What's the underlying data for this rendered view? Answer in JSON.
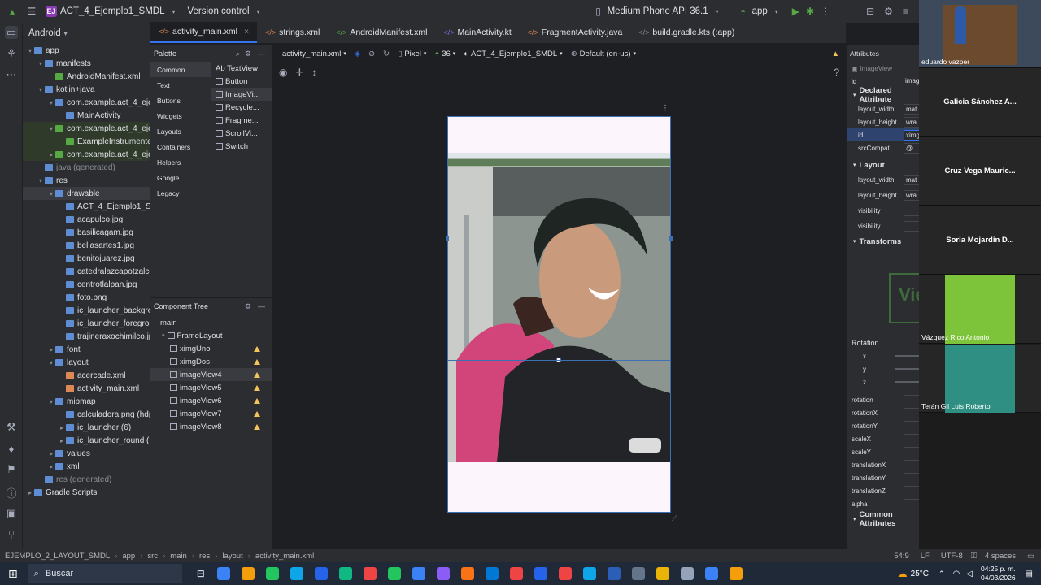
{
  "titlebar": {
    "project_badge": "EJ",
    "project_name": "ACT_4_Ejemplo1_SMDL",
    "vcs": "Version control",
    "device": "Medium Phone API 36.1",
    "run_config": "app"
  },
  "project_panel": {
    "view": "Android",
    "tree": [
      {
        "label": "app",
        "depth": 0,
        "arrow": "▾",
        "color": "#5f8dd3"
      },
      {
        "label": "manifests",
        "depth": 1,
        "arrow": "▾",
        "color": "#5f8dd3"
      },
      {
        "label": "AndroidManifest.xml",
        "depth": 2,
        "arrow": "",
        "color": "#56a845"
      },
      {
        "label": "kotlin+java",
        "depth": 1,
        "arrow": "▾",
        "color": "#5f8dd3"
      },
      {
        "label": "com.example.act_4_ejer",
        "depth": 2,
        "arrow": "▾",
        "color": "#5f8dd3"
      },
      {
        "label": "MainActivity",
        "depth": 3,
        "arrow": "",
        "color": "#5f8dd3"
      },
      {
        "label": "com.example.act_4_ejer",
        "depth": 2,
        "arrow": "▾",
        "color": "#56a845",
        "hl": true
      },
      {
        "label": "ExampleInstrumente",
        "depth": 3,
        "arrow": "",
        "color": "#56a845",
        "hl": true
      },
      {
        "label": "com.example.act_4_ejer",
        "depth": 2,
        "arrow": "▸",
        "color": "#56a845",
        "hl": true
      },
      {
        "label": "java (generated)",
        "depth": 1,
        "arrow": "",
        "color": "#5f8dd3",
        "gen": true
      },
      {
        "label": "res",
        "depth": 1,
        "arrow": "▾",
        "color": "#5f8dd3"
      },
      {
        "label": "drawable",
        "depth": 2,
        "arrow": "▾",
        "color": "#5f8dd3",
        "sel": true
      },
      {
        "label": "ACT_4_Ejemplo1_SMDL",
        "depth": 3,
        "arrow": "",
        "color": "#5f8dd3"
      },
      {
        "label": "acapulco.jpg",
        "depth": 3,
        "arrow": "",
        "color": "#5f8dd3"
      },
      {
        "label": "basilicagam.jpg",
        "depth": 3,
        "arrow": "",
        "color": "#5f8dd3"
      },
      {
        "label": "bellasartes1.jpg",
        "depth": 3,
        "arrow": "",
        "color": "#5f8dd3"
      },
      {
        "label": "benitojuarez.jpg",
        "depth": 3,
        "arrow": "",
        "color": "#5f8dd3"
      },
      {
        "label": "catedralazcapotzalco",
        "depth": 3,
        "arrow": "",
        "color": "#5f8dd3"
      },
      {
        "label": "centrotlalpan.jpg",
        "depth": 3,
        "arrow": "",
        "color": "#5f8dd3"
      },
      {
        "label": "foto.png",
        "depth": 3,
        "arrow": "",
        "color": "#5f8dd3"
      },
      {
        "label": "ic_launcher_backgro",
        "depth": 3,
        "arrow": "",
        "color": "#5f8dd3"
      },
      {
        "label": "ic_launcher_foregrou",
        "depth": 3,
        "arrow": "",
        "color": "#5f8dd3"
      },
      {
        "label": "trajineraxochimilco.jp",
        "depth": 3,
        "arrow": "",
        "color": "#5f8dd3"
      },
      {
        "label": "font",
        "depth": 2,
        "arrow": "▸",
        "color": "#5f8dd3"
      },
      {
        "label": "layout",
        "depth": 2,
        "arrow": "▾",
        "color": "#5f8dd3"
      },
      {
        "label": "acercade.xml",
        "depth": 3,
        "arrow": "",
        "color": "#e08855"
      },
      {
        "label": "activity_main.xml",
        "depth": 3,
        "arrow": "",
        "color": "#e08855"
      },
      {
        "label": "mipmap",
        "depth": 2,
        "arrow": "▾",
        "color": "#5f8dd3"
      },
      {
        "label": "calculadora.png (hdp",
        "depth": 3,
        "arrow": "",
        "color": "#5f8dd3"
      },
      {
        "label": "ic_launcher (6)",
        "depth": 3,
        "arrow": "▸",
        "color": "#5f8dd3"
      },
      {
        "label": "ic_launcher_round (6",
        "depth": 3,
        "arrow": "▸",
        "color": "#5f8dd3"
      },
      {
        "label": "values",
        "depth": 2,
        "arrow": "▸",
        "color": "#5f8dd3"
      },
      {
        "label": "xml",
        "depth": 2,
        "arrow": "▸",
        "color": "#5f8dd3"
      },
      {
        "label": "res (generated)",
        "depth": 1,
        "arrow": "",
        "color": "#5f8dd3",
        "gen": true
      },
      {
        "label": "Gradle Scripts",
        "depth": 0,
        "arrow": "▸",
        "color": "#5f8dd3"
      }
    ]
  },
  "tabs": [
    {
      "label": "activity_main.xml",
      "active": true,
      "color": "#e08855",
      "close": "×"
    },
    {
      "label": "strings.xml",
      "active": false,
      "color": "#e08855",
      "close": ""
    },
    {
      "label": "AndroidManifest.xml",
      "active": false,
      "color": "#56a845",
      "close": ""
    },
    {
      "label": "MainActivity.kt",
      "active": false,
      "color": "#7f6bdd",
      "close": ""
    },
    {
      "label": "FragmentActivity.java",
      "active": false,
      "color": "#e08855",
      "close": ""
    },
    {
      "label": "build.gradle.kts (:app)",
      "active": false,
      "color": "#8c8f96",
      "close": ""
    }
  ],
  "palette": {
    "title": "Palette",
    "categories": [
      "Common",
      "Text",
      "Buttons",
      "Widgets",
      "Layouts",
      "Containers",
      "Helpers",
      "Google",
      "Legacy"
    ],
    "items": [
      "Ab TextView",
      "Button",
      "ImageVi...",
      "Recycle...",
      "Fragme...",
      "ScrollVi...",
      "Switch"
    ]
  },
  "component_tree": {
    "title": "Component Tree",
    "rows": [
      {
        "label": "main",
        "depth": 0,
        "warn": false,
        "sel": false
      },
      {
        "label": "FrameLayout",
        "depth": 1,
        "warn": false,
        "sel": false
      },
      {
        "label": "ximgUno",
        "depth": 2,
        "warn": true,
        "sel": false
      },
      {
        "label": "ximgDos",
        "depth": 2,
        "warn": true,
        "sel": false
      },
      {
        "label": "imageView4",
        "depth": 2,
        "warn": true,
        "sel": true
      },
      {
        "label": "imageView5",
        "depth": 2,
        "warn": true,
        "sel": false
      },
      {
        "label": "imageView6",
        "depth": 2,
        "warn": true,
        "sel": false
      },
      {
        "label": "imageView7",
        "depth": 2,
        "warn": true,
        "sel": false
      },
      {
        "label": "imageView8",
        "depth": 2,
        "warn": true,
        "sel": false
      }
    ]
  },
  "design_toolbar": {
    "file": "activity_main.xml",
    "device": "Pixel",
    "api": "36",
    "theme": "ACT_4_Ejemplo1_SMDL",
    "locale": "Default (en-us)"
  },
  "attributes": {
    "title": "Attributes",
    "component": "ImageView",
    "id_label": "id",
    "id_value": "imag",
    "declared": "Declared Attribute",
    "declared_rows": [
      {
        "k": "layout_width",
        "v": "mat"
      },
      {
        "k": "layout_height",
        "v": "wra"
      },
      {
        "k": "id",
        "v": "ximg"
      },
      {
        "k": "srcCompat",
        "v": "@"
      }
    ],
    "layout_section": "Layout",
    "layout_rows": [
      {
        "k": "layout_width",
        "v": "mat"
      },
      {
        "k": "layout_height",
        "v": "wra"
      },
      {
        "k": "visibility",
        "v": ""
      },
      {
        "k": "visibility",
        "v": ""
      }
    ],
    "transforms": "Transforms",
    "preview_text": "Vie",
    "rotation_label": "Rotation",
    "axes": [
      "x",
      "y",
      "z"
    ],
    "transform_rows": [
      "rotation",
      "rotationX",
      "rotationY",
      "scaleX",
      "scaleY",
      "translationX",
      "translationY",
      "translationZ",
      "alpha"
    ],
    "common": "Common Attributes"
  },
  "video_call": {
    "participants": [
      {
        "name": "eduardo vazper",
        "type": "video"
      },
      {
        "name": "Galicia Sánchez A...",
        "type": "text"
      },
      {
        "name": "Cruz Vega Mauric...",
        "type": "text"
      },
      {
        "name": "Soria Mojardin D...",
        "type": "text"
      },
      {
        "name": "Vázquez Rico Antonio",
        "type": "avatar-green"
      },
      {
        "name": "Terán Gil Luis Roberto",
        "type": "avatar-anime"
      }
    ]
  },
  "statusbar": {
    "breadcrumb": [
      "EJEMPLO_2_LAYOUT_SMDL",
      "app",
      "src",
      "main",
      "res",
      "layout",
      "activity_main.xml"
    ],
    "position": "54:9",
    "line_sep": "LF",
    "encoding": "UTF-8",
    "indent": "4 spaces"
  },
  "taskbar": {
    "search": "Buscar",
    "temp": "25°C",
    "time": "04:25 p. m.",
    "date": "04/03/2026",
    "colors": [
      "#3b82f6",
      "#f59e0b",
      "#22c55e",
      "#0ea5e9",
      "#2563eb",
      "#10b981",
      "#ef4444",
      "#22c55e",
      "#3b82f6",
      "#8b5cf6",
      "#f97316",
      "#0078d4",
      "#ef4444",
      "#2563eb",
      "#ef4444",
      "#0ea5e9",
      "#2b5fb7",
      "#64748b",
      "#eab308",
      "#94a3b8",
      "#3b82f6",
      "#f59e0b"
    ]
  }
}
